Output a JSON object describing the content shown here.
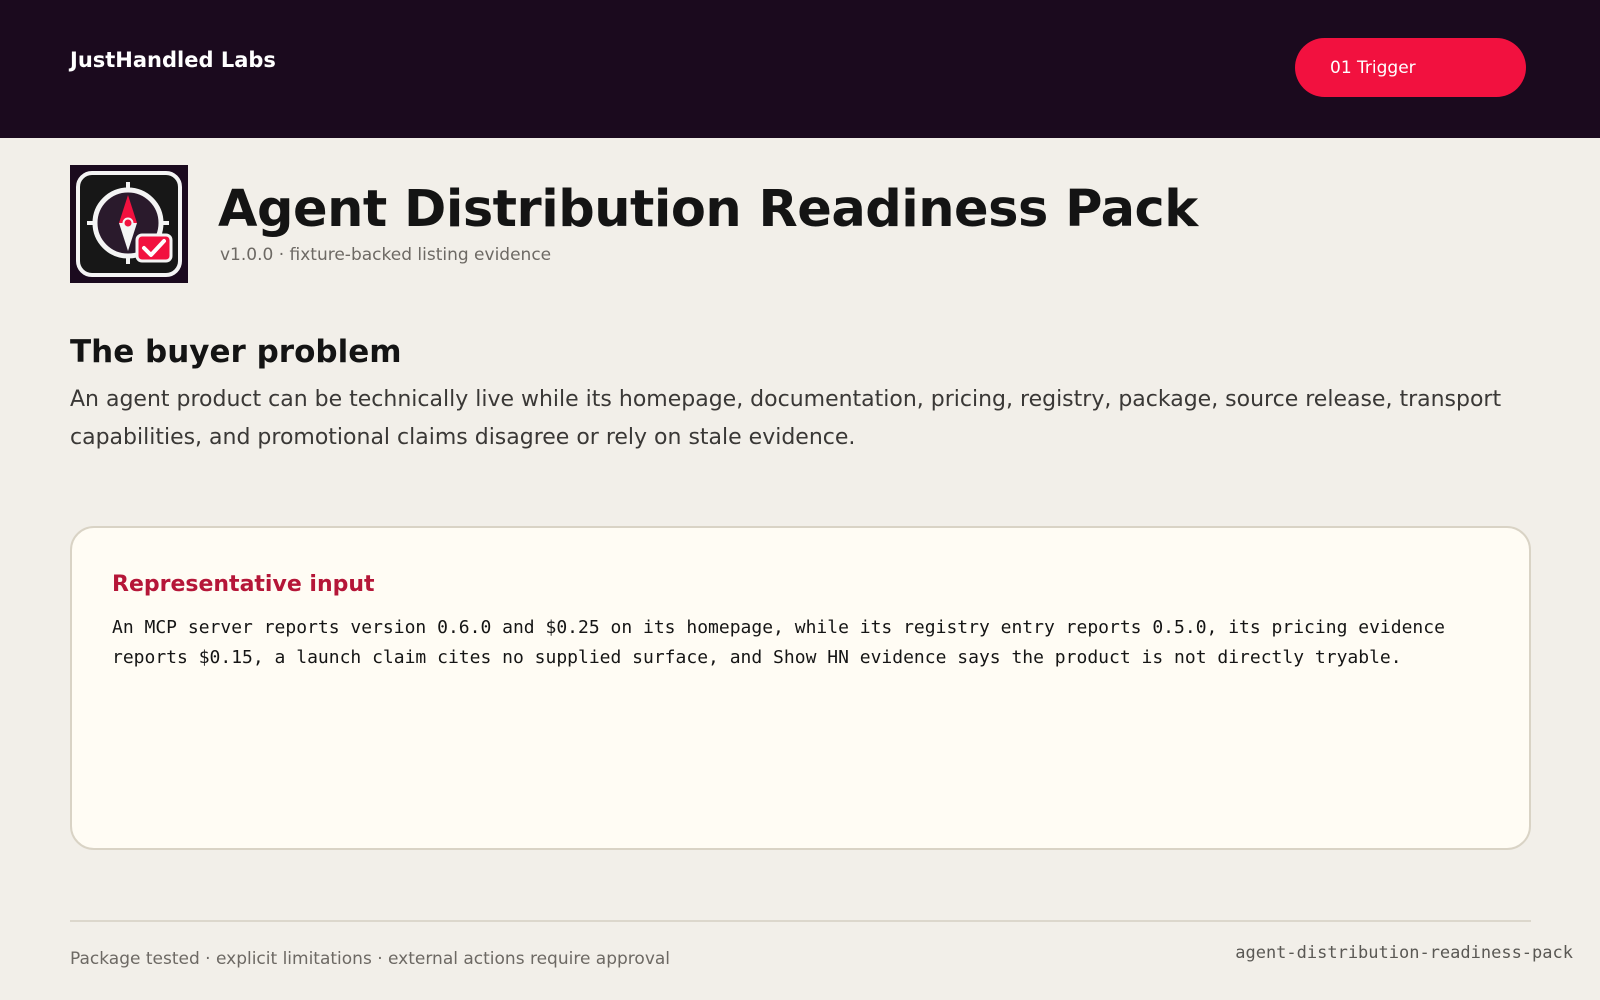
{
  "header": {
    "brand": "JustHandled Labs",
    "trigger_label": "01 Trigger"
  },
  "product": {
    "logo_icon": "compass-check-icon",
    "title": "Agent Distribution Readiness Pack",
    "subtitle": "v1.0.0 · fixture-backed listing evidence"
  },
  "problem": {
    "heading": "The buyer problem",
    "body": "An agent product can be technically live while its homepage, documentation, pricing, registry, package, source release, transport capabilities, and promotional claims disagree or rely on stale evidence."
  },
  "input_card": {
    "heading": "Representative input",
    "body": "An MCP server reports version 0.6.0 and $0.25 on its homepage, while its registry entry reports 0.5.0, its pricing evidence reports $0.15, a launch claim cites no supplied surface, and Show HN evidence says the product is not directly tryable."
  },
  "footer": {
    "note": "Package tested · explicit limitations · external actions require approval",
    "slug": "agent-distribution-readiness-pack"
  },
  "colors": {
    "header_bg": "#1b0a1e",
    "accent": "#f2113f",
    "card_heading": "#b51638",
    "page_bg": "#f2efe9",
    "card_bg": "#fffcf4"
  }
}
